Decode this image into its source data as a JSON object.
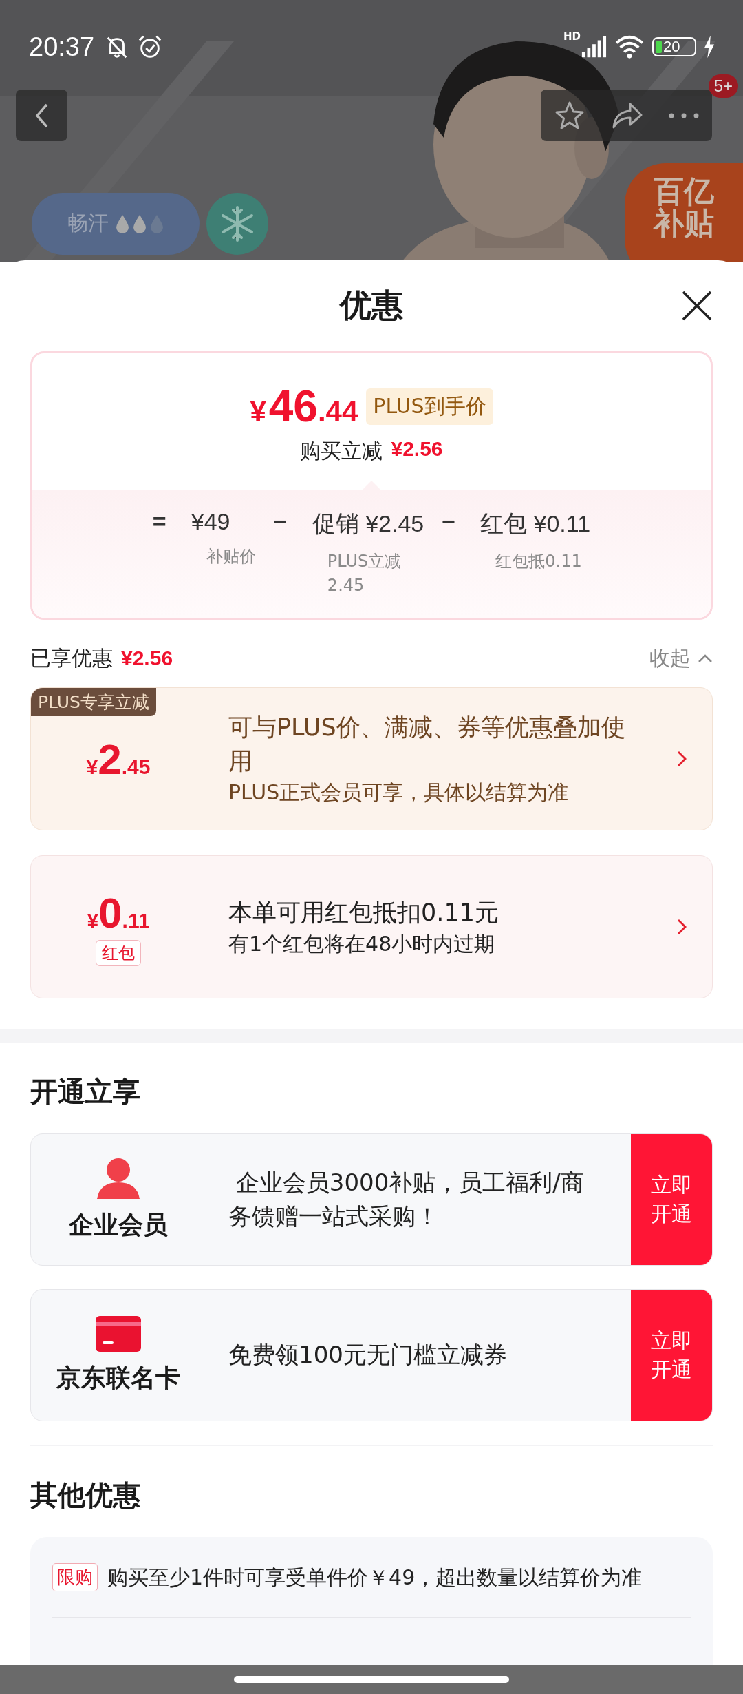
{
  "status_bar": {
    "time": "20:37",
    "network_label": "HD",
    "battery": "20"
  },
  "top_bar": {
    "badge": "5+"
  },
  "product_banner": {
    "feature_label": "畅汗",
    "sweat_drops": [
      {
        "filled": true
      },
      {
        "filled": true
      },
      {
        "filled": false
      }
    ],
    "subsidy_badge": [
      "百亿",
      "补贴"
    ]
  },
  "sheet": {
    "title": "优惠"
  },
  "summary": {
    "price": {
      "symbol": "¥",
      "integer": "46",
      "decimal": ".44"
    },
    "price_tag": "PLUS到手价",
    "reduction_label": "购买立减",
    "reduction_amount": "¥2.56",
    "breakdown": [
      {
        "operator": "=",
        "value": "¥49",
        "note": "补贴价"
      },
      {
        "operator": "−",
        "value": "促销 ¥2.45",
        "note": "PLUS立减2.45"
      },
      {
        "operator": "−",
        "value": "红包 ¥0.11",
        "note": "红包抵0.11"
      }
    ]
  },
  "enjoyed": {
    "label": "已享优惠",
    "amount": "¥2.56",
    "toggle": "收起",
    "expanded": true
  },
  "offers": [
    {
      "kind": "plus",
      "tag": "PLUS专享立减",
      "symbol": "¥",
      "integer": "2",
      "decimal": ".45",
      "title": "可与PLUS价、满减、券等优惠叠加使用",
      "subtitle": "PLUS正式会员可享，具体以结算为准"
    },
    {
      "kind": "redpacket",
      "symbol": "¥",
      "integer": "0",
      "decimal": ".11",
      "label": "红包",
      "title": "本单可用红包抵扣0.11元",
      "subtitle": "有1个红包将在48小时内过期"
    }
  ],
  "open_section": {
    "title": "开通立享",
    "items": [
      {
        "kind": "person",
        "name": "企业会员",
        "text": " 企业会员3000补贴，员工福利/商务馈赠一站式采购！",
        "button": "立即开通"
      },
      {
        "kind": "card",
        "name": "京东联名卡",
        "text": "免费领100元无门槛立减券",
        "button": "立即开通"
      }
    ]
  },
  "other_section": {
    "title": "其他优惠",
    "items": [
      {
        "tag": "限购",
        "text": "购买至少1件时可享受单件价￥49，超出数量以结算价为准"
      }
    ]
  }
}
